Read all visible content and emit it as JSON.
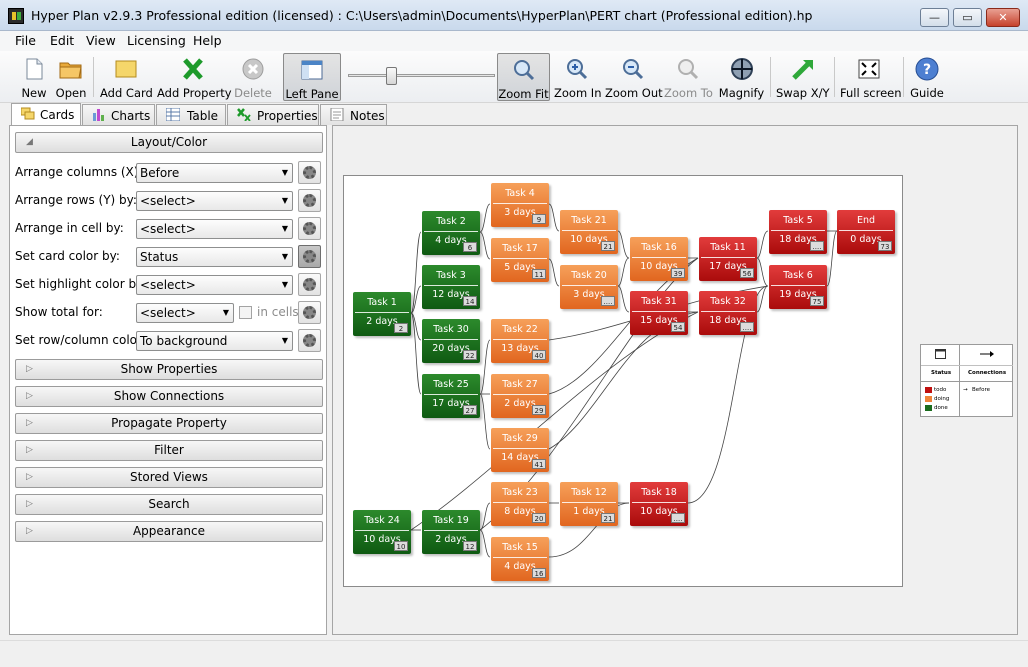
{
  "window": {
    "title": "Hyper Plan v2.9.3 Professional edition (licensed) : C:\\Users\\admin\\Documents\\HyperPlan\\PERT chart (Professional edition).hp",
    "controls": {
      "minimize": "—",
      "maximize": "▭",
      "close": "✕"
    }
  },
  "menu": [
    "File",
    "Edit",
    "View",
    "Licensing",
    "Help"
  ],
  "toolbar": {
    "new": "New",
    "open": "Open",
    "add_card": "Add Card",
    "add_property": "Add Property",
    "delete": "Delete",
    "left_pane": "Left Pane",
    "zoom_fit": "Zoom Fit",
    "zoom_in": "Zoom In",
    "zoom_out": "Zoom Out",
    "zoom_to": "Zoom To",
    "magnify": "Magnify",
    "swap_xy": "Swap X/Y",
    "full_screen": "Full screen",
    "guide": "Guide",
    "zoom_level": 0.28
  },
  "tabs": [
    "Cards",
    "Charts",
    "Table",
    "Properties",
    "Notes"
  ],
  "left_panel": {
    "layout_header": "Layout/Color",
    "rows": [
      {
        "label": "Arrange columns (X) by:",
        "value": "Before"
      },
      {
        "label": "Arrange rows (Y) by:",
        "value": "<select>"
      },
      {
        "label": "Arrange in cell by:",
        "value": "<select>"
      },
      {
        "label": "Set card color by:",
        "value": "Status"
      },
      {
        "label": "Set highlight color by:",
        "value": "<select>"
      },
      {
        "label": "Show total for:",
        "value": "<select>",
        "checkbox_label": "in cells"
      },
      {
        "label": "Set row/column color:",
        "value": "To background"
      }
    ],
    "sections": [
      "Show Properties",
      "Show Connections",
      "Propagate Property",
      "Filter",
      "Stored Views",
      "Search",
      "Appearance"
    ]
  },
  "cards": [
    {
      "name": "Task 1",
      "duration": "2 days",
      "badge": "2",
      "status": "done"
    },
    {
      "name": "Task 2",
      "duration": "4 days",
      "badge": "6",
      "status": "done"
    },
    {
      "name": "Task 3",
      "duration": "12 days",
      "badge": "14",
      "status": "done"
    },
    {
      "name": "Task 30",
      "duration": "20 days",
      "badge": "22",
      "status": "done"
    },
    {
      "name": "Task 25",
      "duration": "17 days",
      "badge": "27",
      "status": "done"
    },
    {
      "name": "Task 24",
      "duration": "10 days",
      "badge": "10",
      "status": "done"
    },
    {
      "name": "Task 19",
      "duration": "2 days",
      "badge": "12",
      "status": "done"
    },
    {
      "name": "Task 4",
      "duration": "3 days",
      "badge": "9",
      "status": "doing"
    },
    {
      "name": "Task 17",
      "duration": "5 days",
      "badge": "11",
      "status": "doing"
    },
    {
      "name": "Task 22",
      "duration": "13 days",
      "badge": "40",
      "status": "doing"
    },
    {
      "name": "Task 27",
      "duration": "2 days",
      "badge": "29",
      "status": "doing"
    },
    {
      "name": "Task 29",
      "duration": "14 days",
      "badge": "41",
      "status": "doing"
    },
    {
      "name": "Task 23",
      "duration": "8 days",
      "badge": "20",
      "status": "doing"
    },
    {
      "name": "Task 15",
      "duration": "4 days",
      "badge": "16",
      "status": "doing"
    },
    {
      "name": "Task 21",
      "duration": "10 days",
      "badge": "21",
      "status": "doing"
    },
    {
      "name": "Task 20",
      "duration": "3 days",
      "badge": "....",
      "status": "doing"
    },
    {
      "name": "Task 12",
      "duration": "1 days",
      "badge": "21",
      "status": "doing"
    },
    {
      "name": "Task 16",
      "duration": "10 days",
      "badge": "39",
      "status": "doing"
    },
    {
      "name": "Task 31",
      "duration": "15 days",
      "badge": "54",
      "status": "todo"
    },
    {
      "name": "Task 18",
      "duration": "10 days",
      "badge": "....",
      "status": "todo"
    },
    {
      "name": "Task 11",
      "duration": "17 days",
      "badge": "56",
      "status": "todo"
    },
    {
      "name": "Task 32",
      "duration": "18 days",
      "badge": "....",
      "status": "todo"
    },
    {
      "name": "Task 5",
      "duration": "18 days",
      "badge": "....",
      "status": "todo"
    },
    {
      "name": "Task 6",
      "duration": "19 days",
      "badge": "75",
      "status": "todo"
    },
    {
      "name": "End",
      "duration": "0 days",
      "badge": "73",
      "status": "todo"
    }
  ],
  "legend": {
    "status_header": "Status",
    "connections_header": "Connections",
    "items": [
      {
        "label": "todo",
        "color": "#c0100f"
      },
      {
        "label": "doing",
        "color": "#f0843a"
      },
      {
        "label": "done",
        "color": "#1a6b1c"
      }
    ],
    "connection_label": "Before"
  },
  "colors": {
    "done": "#1a6b1c",
    "doing": "#f0843a",
    "todo": "#c0100f"
  }
}
